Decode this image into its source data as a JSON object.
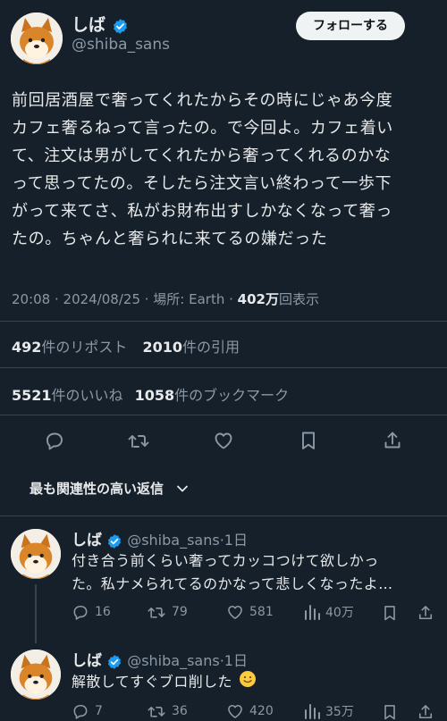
{
  "author": {
    "name": "しば",
    "handle": "@shiba_sans",
    "follow_label": "フォローする"
  },
  "tweet": {
    "lines": [
      "前回居酒屋で奢ってくれたからその時にじゃあ今度",
      "カフェ奢るねって言ったの。で今回よ。カフェ着い",
      "て、注文は男がしてくれたから奢ってくれるのかな",
      "って思ってたの。そしたら注文言い終わって一歩下",
      "がって来てさ、私がお財布出すしかなくなって奢っ",
      "たの。ちゃんと奢られに来てるの嫌だった"
    ],
    "meta": "20:08 · 2024/08/25 · 場所: Earth · ",
    "views_value": "402万",
    "views_label": "回表示"
  },
  "stats": {
    "reposts_value": "492",
    "reposts_label": "件のリポスト",
    "quotes_value": "2010",
    "quotes_label": "件の引用",
    "likes_value": "5521",
    "likes_label": "件のいいね",
    "bookmarks_value": "1058",
    "bookmarks_label": "件のブックマーク"
  },
  "actions_icons": [
    "reply-icon",
    "repost-icon",
    "like-icon",
    "bookmark-icon",
    "share-icon"
  ],
  "sort": {
    "label": "最も関連性の高い返信"
  },
  "replies": [
    {
      "name": "しば",
      "handle": "@shiba_sans",
      "time": "·1日",
      "lines": [
        "付き合う前くらい奢ってカッコつけて欲しかっ",
        "た。私ナメられてるのかなって悲しくなったよ…"
      ],
      "replies": "16",
      "reposts": "79",
      "likes": "581",
      "views": "40万"
    },
    {
      "name": "しば",
      "handle": "@shiba_sans",
      "time": "·1日",
      "lines": [
        "解散してすぐブロ削した"
      ],
      "replies": "7",
      "reposts": "36",
      "likes": "420",
      "views": "35万"
    }
  ],
  "colors": {
    "background": "#15202b",
    "verified": "#1d9bf0",
    "muted": "#8b98a5",
    "divider": "#38444d"
  }
}
